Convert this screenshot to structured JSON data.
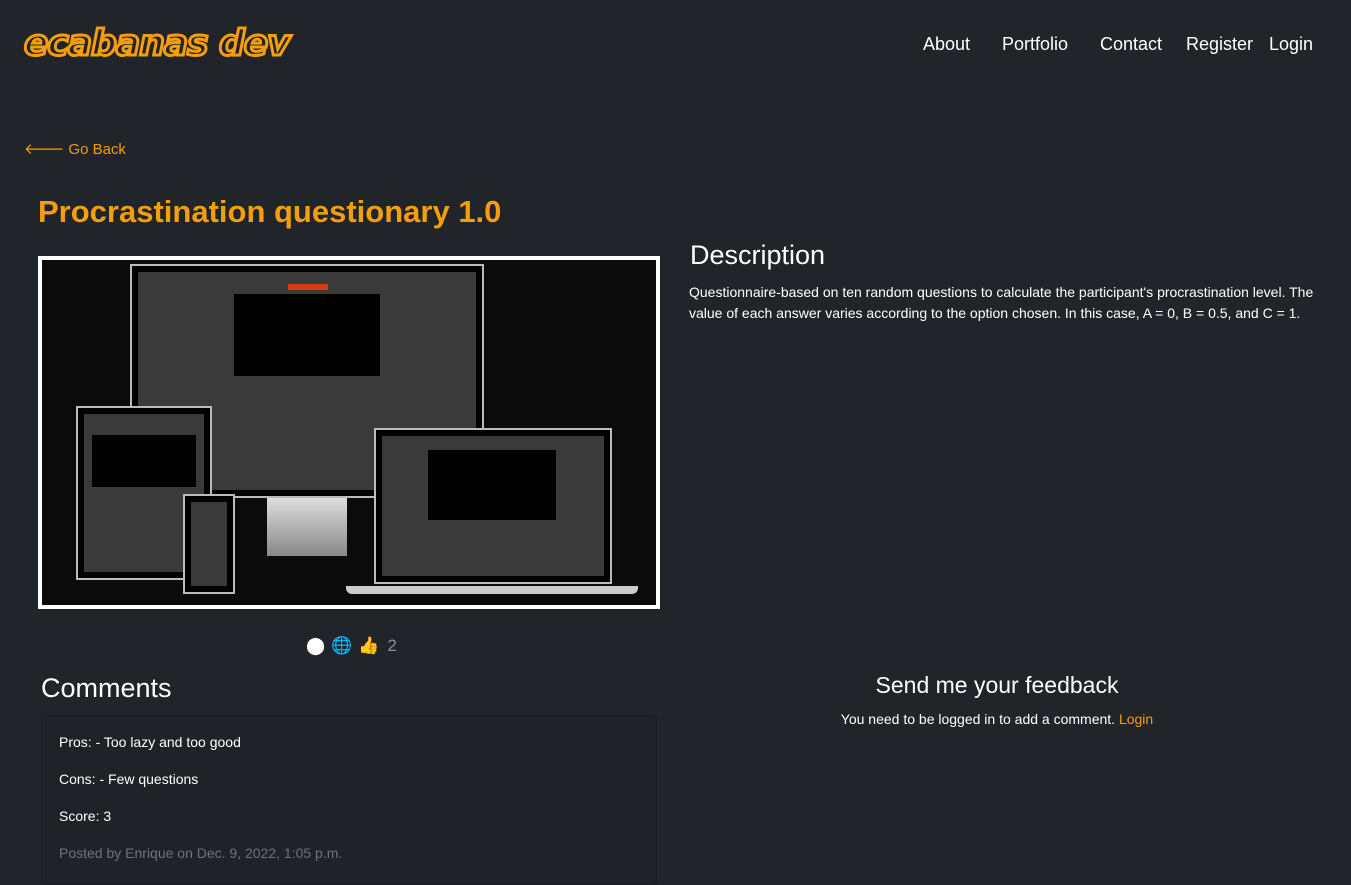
{
  "header": {
    "logo": "ecabanas dev",
    "nav": [
      "About",
      "Portfolio",
      "Contact",
      "Register",
      "Login"
    ]
  },
  "go_back": "Go Back",
  "project": {
    "title": "Procrastination questionary 1.0",
    "likes": "2",
    "icons": [
      "github-icon",
      "globe-icon",
      "thumbs-up-icon"
    ]
  },
  "description": {
    "heading": "Description",
    "text": "Questionnaire-based on ten random questions to calculate the participant's procrastination level. The value of each answer varies according to the option chosen. In this case, A = 0, B = 0.5, and C = 1."
  },
  "comments": {
    "heading": "Comments",
    "items": [
      {
        "pros": "Pros: - Too lazy and too good",
        "cons": "Cons: - Few questions",
        "score": "Score: 3",
        "meta": "Posted by Enrique on Dec. 9, 2022, 1:05 p.m."
      }
    ]
  },
  "feedback": {
    "heading": "Send me your feedback",
    "text": "You need to be logged in to add a comment.",
    "login": "Login"
  },
  "colors": {
    "accent": "#f59e0b",
    "background": "#212429"
  }
}
